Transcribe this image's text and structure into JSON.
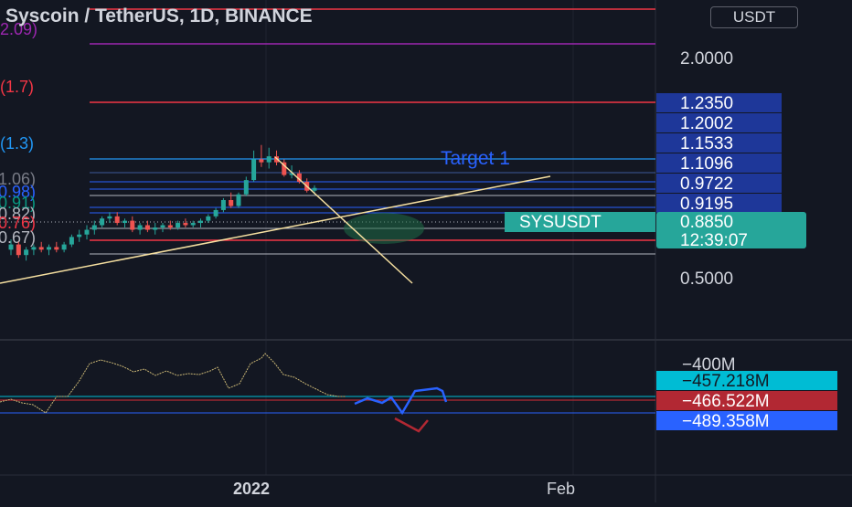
{
  "header": {
    "title": "Syscoin / TetherUS, 1D, BINANCE",
    "currency": "USDT"
  },
  "chart_data": {
    "type": "candlestick",
    "symbol": "SYSUSDT",
    "price_axis": {
      "scale": "log",
      "ticks": [
        "2.0000",
        "0.5000"
      ]
    },
    "fib_labels": [
      {
        "text": "(2.09)",
        "price": 2.09,
        "color": "#9c27b0"
      },
      {
        "text": "(1.7)",
        "price": 1.7,
        "color": "#f23645"
      },
      {
        "text": "(1.3)",
        "price": 1.3,
        "color": "#2196f3"
      },
      {
        "text": "(1.06)",
        "price": 1.06,
        "color": "#787b86"
      },
      {
        "text": "(0.98)",
        "price": 0.98,
        "color": "#2962ff"
      },
      {
        "text": "(0.91)",
        "price": 0.91,
        "color": "#089981"
      },
      {
        "text": "(0.82)",
        "price": 0.82,
        "color": "#b2b5be"
      },
      {
        "text": "(0.76)",
        "price": 0.76,
        "color": "#f23645"
      },
      {
        "text": "(0.67)",
        "price": 0.67,
        "color": "#b2b5be"
      }
    ],
    "level_tags": [
      "1.2350",
      "1.2002",
      "1.1533",
      "1.1096",
      "0.9722",
      "0.9195"
    ],
    "last_price": {
      "symbol": "SYSUSDT",
      "price": "0.8850",
      "price_value": 0.885,
      "countdown": "12:39:07",
      "color": "#26a69a"
    },
    "annotation": "Target 1",
    "time_axis": [
      "2022",
      "Feb"
    ],
    "candles": [
      [
        0.6,
        0.64,
        0.58,
        0.62
      ],
      [
        0.62,
        0.63,
        0.57,
        0.58
      ],
      [
        0.58,
        0.61,
        0.56,
        0.6
      ],
      [
        0.6,
        0.62,
        0.58,
        0.61
      ],
      [
        0.61,
        0.63,
        0.59,
        0.6
      ],
      [
        0.6,
        0.62,
        0.58,
        0.61
      ],
      [
        0.61,
        0.63,
        0.59,
        0.6
      ],
      [
        0.6,
        0.63,
        0.59,
        0.62
      ],
      [
        0.62,
        0.66,
        0.61,
        0.65
      ],
      [
        0.65,
        0.68,
        0.63,
        0.66
      ],
      [
        0.66,
        0.7,
        0.64,
        0.68
      ],
      [
        0.68,
        0.72,
        0.66,
        0.7
      ],
      [
        0.7,
        0.74,
        0.69,
        0.73
      ],
      [
        0.73,
        0.76,
        0.71,
        0.74
      ],
      [
        0.74,
        0.76,
        0.7,
        0.71
      ],
      [
        0.71,
        0.73,
        0.69,
        0.72
      ],
      [
        0.72,
        0.74,
        0.67,
        0.68
      ],
      [
        0.68,
        0.71,
        0.66,
        0.7
      ],
      [
        0.7,
        0.72,
        0.67,
        0.68
      ],
      [
        0.68,
        0.71,
        0.66,
        0.69
      ],
      [
        0.69,
        0.71,
        0.67,
        0.7
      ],
      [
        0.7,
        0.72,
        0.68,
        0.69
      ],
      [
        0.69,
        0.72,
        0.68,
        0.71
      ],
      [
        0.71,
        0.73,
        0.69,
        0.7
      ],
      [
        0.7,
        0.72,
        0.69,
        0.71
      ],
      [
        0.71,
        0.73,
        0.69,
        0.72
      ],
      [
        0.72,
        0.75,
        0.71,
        0.74
      ],
      [
        0.74,
        0.78,
        0.73,
        0.77
      ],
      [
        0.77,
        0.83,
        0.76,
        0.82
      ],
      [
        0.82,
        0.86,
        0.78,
        0.79
      ],
      [
        0.79,
        0.86,
        0.78,
        0.85
      ],
      [
        0.85,
        0.95,
        0.84,
        0.93
      ],
      [
        0.93,
        1.12,
        0.92,
        1.06
      ],
      [
        1.06,
        1.16,
        1.01,
        1.04
      ],
      [
        1.04,
        1.14,
        1.0,
        1.08
      ],
      [
        1.08,
        1.12,
        1.02,
        1.04
      ],
      [
        1.04,
        1.06,
        0.95,
        0.96
      ],
      [
        0.96,
        1.02,
        0.94,
        0.97
      ],
      [
        0.97,
        0.99,
        0.91,
        0.92
      ],
      [
        0.92,
        0.94,
        0.86,
        0.87
      ],
      [
        0.87,
        0.9,
        0.85,
        0.885
      ]
    ],
    "indicator": {
      "axis_ticks": [
        "−400M"
      ],
      "value_tags": [
        {
          "text": "−457.218M",
          "value": -457.218,
          "color": "#00bcd4"
        },
        {
          "text": "−466.522M",
          "value": -466.522,
          "color": "#b22833"
        },
        {
          "text": "−489.358M",
          "value": -489.358,
          "color": "#2962ff"
        }
      ]
    }
  }
}
